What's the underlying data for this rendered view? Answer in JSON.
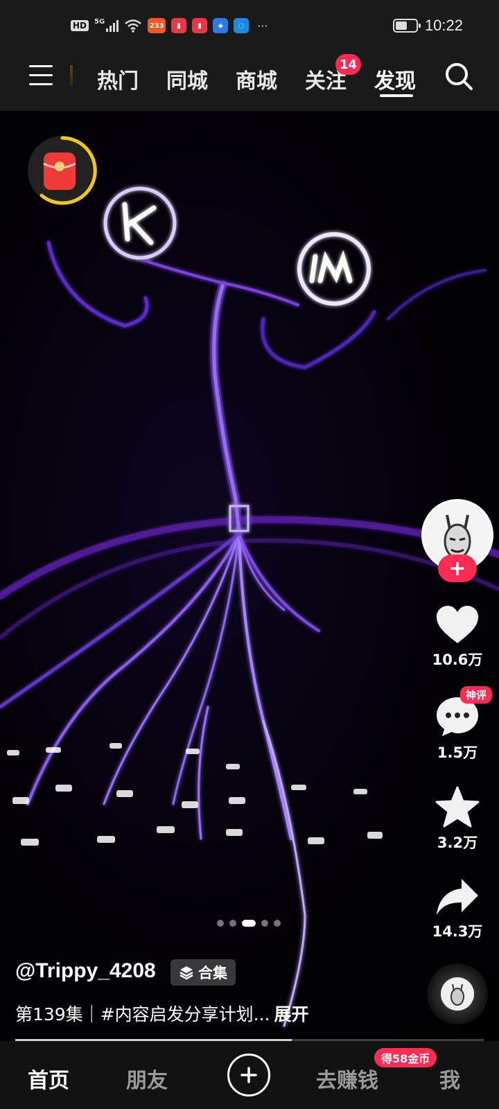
{
  "status_bar": {
    "hd_label": "HD",
    "network": "5G",
    "app_badge_text": "233",
    "time": "10:22",
    "more": "···"
  },
  "top_nav": {
    "tabs": [
      {
        "label": "热门"
      },
      {
        "label": "同城"
      },
      {
        "label": "商城"
      },
      {
        "label": "关注",
        "badge": "14"
      },
      {
        "label": "发现",
        "active": true
      }
    ]
  },
  "video": {
    "author": "@Trippy_4208",
    "collection_label": "合集",
    "caption": "第139集｜#内容启发分享计划...",
    "expand_label": "展开",
    "carousel_dots": 5,
    "carousel_active": 3,
    "progress": 0.59
  },
  "actions": {
    "likes": "10.6万",
    "comments": "1.5万",
    "comment_badge": "神评",
    "favorites": "3.2万",
    "shares": "14.3万"
  },
  "bottom_nav": {
    "home": "首页",
    "friends": "朋友",
    "earn": "去赚钱",
    "earn_badge": "得58金币",
    "me": "我"
  },
  "colors": {
    "accent": "#fe2c55",
    "background": "#000000",
    "bar": "#1a1a1a"
  }
}
